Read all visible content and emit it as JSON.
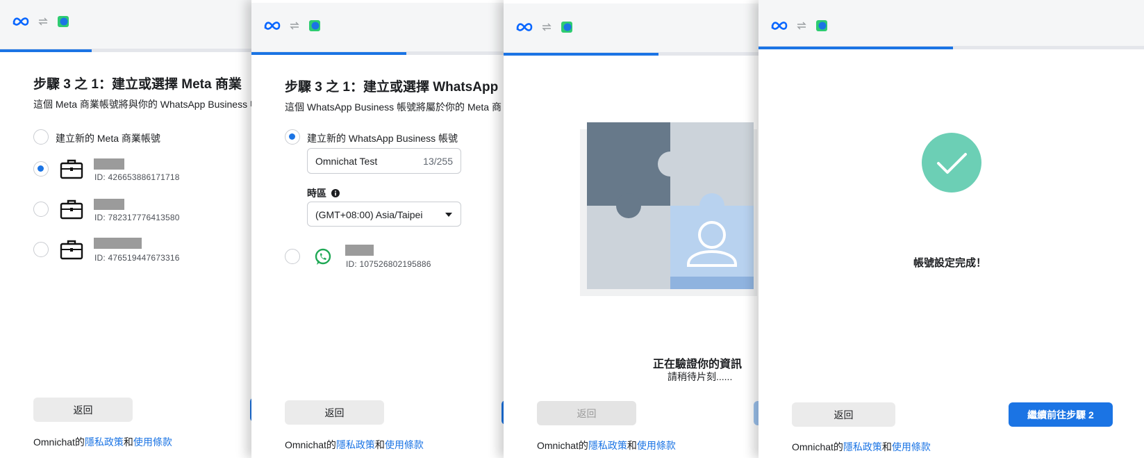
{
  "colors": {
    "accent": "#1b74e4",
    "success": "#6ccfb5",
    "gray_bg": "#f5f6f7"
  },
  "icons": [
    "meta-logo-icon",
    "sync-arrows-icon",
    "omnichat-logo-icon",
    "briefcase-icon",
    "whatsapp-icon",
    "info-icon",
    "caret-down-icon",
    "checkmark-icon",
    "puzzle-illustration"
  ],
  "panel1": {
    "progress": 0.38,
    "title": "步驟 3 之 1：建立或選擇 Meta 商業",
    "subtitle": "這個 Meta 商業帳號將與你的 WhatsApp Business 帳",
    "option_new": "建立新的 Meta 商業帳號",
    "accounts": [
      {
        "id": "ID: 426653886171718",
        "selected": true
      },
      {
        "id": "ID: 782317776413580",
        "selected": false
      },
      {
        "id": "ID: 476519447673316",
        "selected": false
      }
    ],
    "back": "返回",
    "footer": {
      "prefix": "Omnichat的",
      "privacy": "隱私政策",
      "and": "和",
      "terms": "使用條款"
    }
  },
  "panel2": {
    "progress": 0.61,
    "title": "步驟 3 之 1：建立或選擇 WhatsApp",
    "subtitle": "這個 WhatsApp Business 帳號將屬於你的 Meta 商",
    "option_new": "建立新的 WhatsApp Business 帳號",
    "name_value": "Omnichat Test",
    "name_counter": "13/255",
    "timezone_label": "時區",
    "timezone_value": "(GMT+08:00) Asia/Taipei",
    "existing_id": "ID: 107526802195886",
    "back": "返回",
    "footer": {
      "prefix": "Omnichat的",
      "privacy": "隱私政策",
      "and": "和",
      "terms": "使用條款"
    }
  },
  "panel3": {
    "progress": 0.61,
    "verifying_title": "正在驗證你的資訊",
    "verifying_sub": "請稍待片刻......",
    "back": "返回",
    "footer": {
      "prefix": "Omnichat的",
      "privacy": "隱私政策",
      "and": "和",
      "terms": "使用條款"
    }
  },
  "panel4": {
    "progress": 0.51,
    "done_text": "帳號設定完成！",
    "back": "返回",
    "continue": "繼續前往步驟 2",
    "footer": {
      "prefix": "Omnichat的",
      "privacy": "隱私政策",
      "and": "和",
      "terms": "使用條款"
    }
  }
}
